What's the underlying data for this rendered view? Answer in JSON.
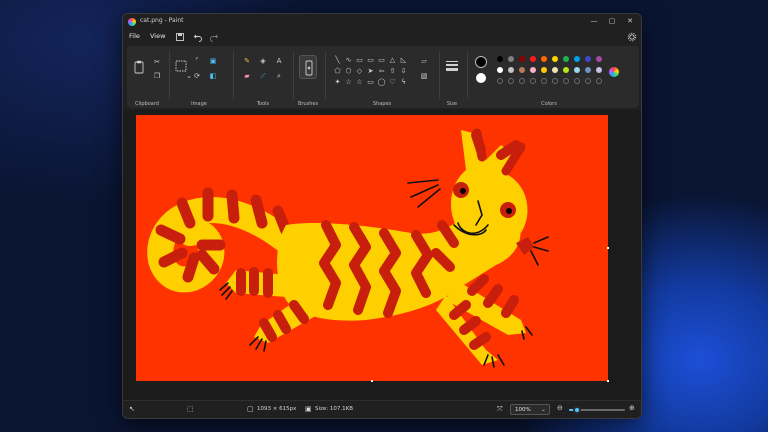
{
  "window": {
    "title": "cat.png - Paint"
  },
  "titlebar": {
    "minimize": "—",
    "maximize": "▢",
    "close": "✕"
  },
  "menu": {
    "file": "File",
    "view": "View"
  },
  "ribbon": {
    "groups": {
      "clipboard": "Clipboard",
      "image": "Image",
      "tools": "Tools",
      "brushes": "Brushes",
      "shapes": "Shapes",
      "size": "Size",
      "colors": "Colors"
    },
    "shape_glyphs": [
      "╲",
      "∿",
      "▭",
      "▭",
      "▭",
      "△",
      "◺",
      "⬠",
      "⬡",
      "◇",
      "➤",
      "⇦",
      "⇧",
      "⇩",
      "✦",
      "☆",
      "☆",
      "▭",
      "◯",
      "♡",
      "ϟ"
    ],
    "palette_row1": [
      "#000000",
      "#7f7f7f",
      "#8b0000",
      "#ff1a1a",
      "#ff6a00",
      "#ffd400",
      "#22b14c",
      "#00a2e8",
      "#3f48cc",
      "#a349a4"
    ],
    "palette_row2": [
      "#ffffff",
      "#c3c3c3",
      "#b97a57",
      "#ffaec9",
      "#ffc90e",
      "#efe4b0",
      "#b5e61d",
      "#99d9ea",
      "#7092be",
      "#c8bfe7"
    ],
    "primary_color": "#000000",
    "secondary_color": "#ffffff"
  },
  "status": {
    "selection_size": "",
    "image_dimensions": "1093 × 615px",
    "file_size": "Size: 107.1KB",
    "zoom": "100%",
    "zoom_level": 0.15
  }
}
